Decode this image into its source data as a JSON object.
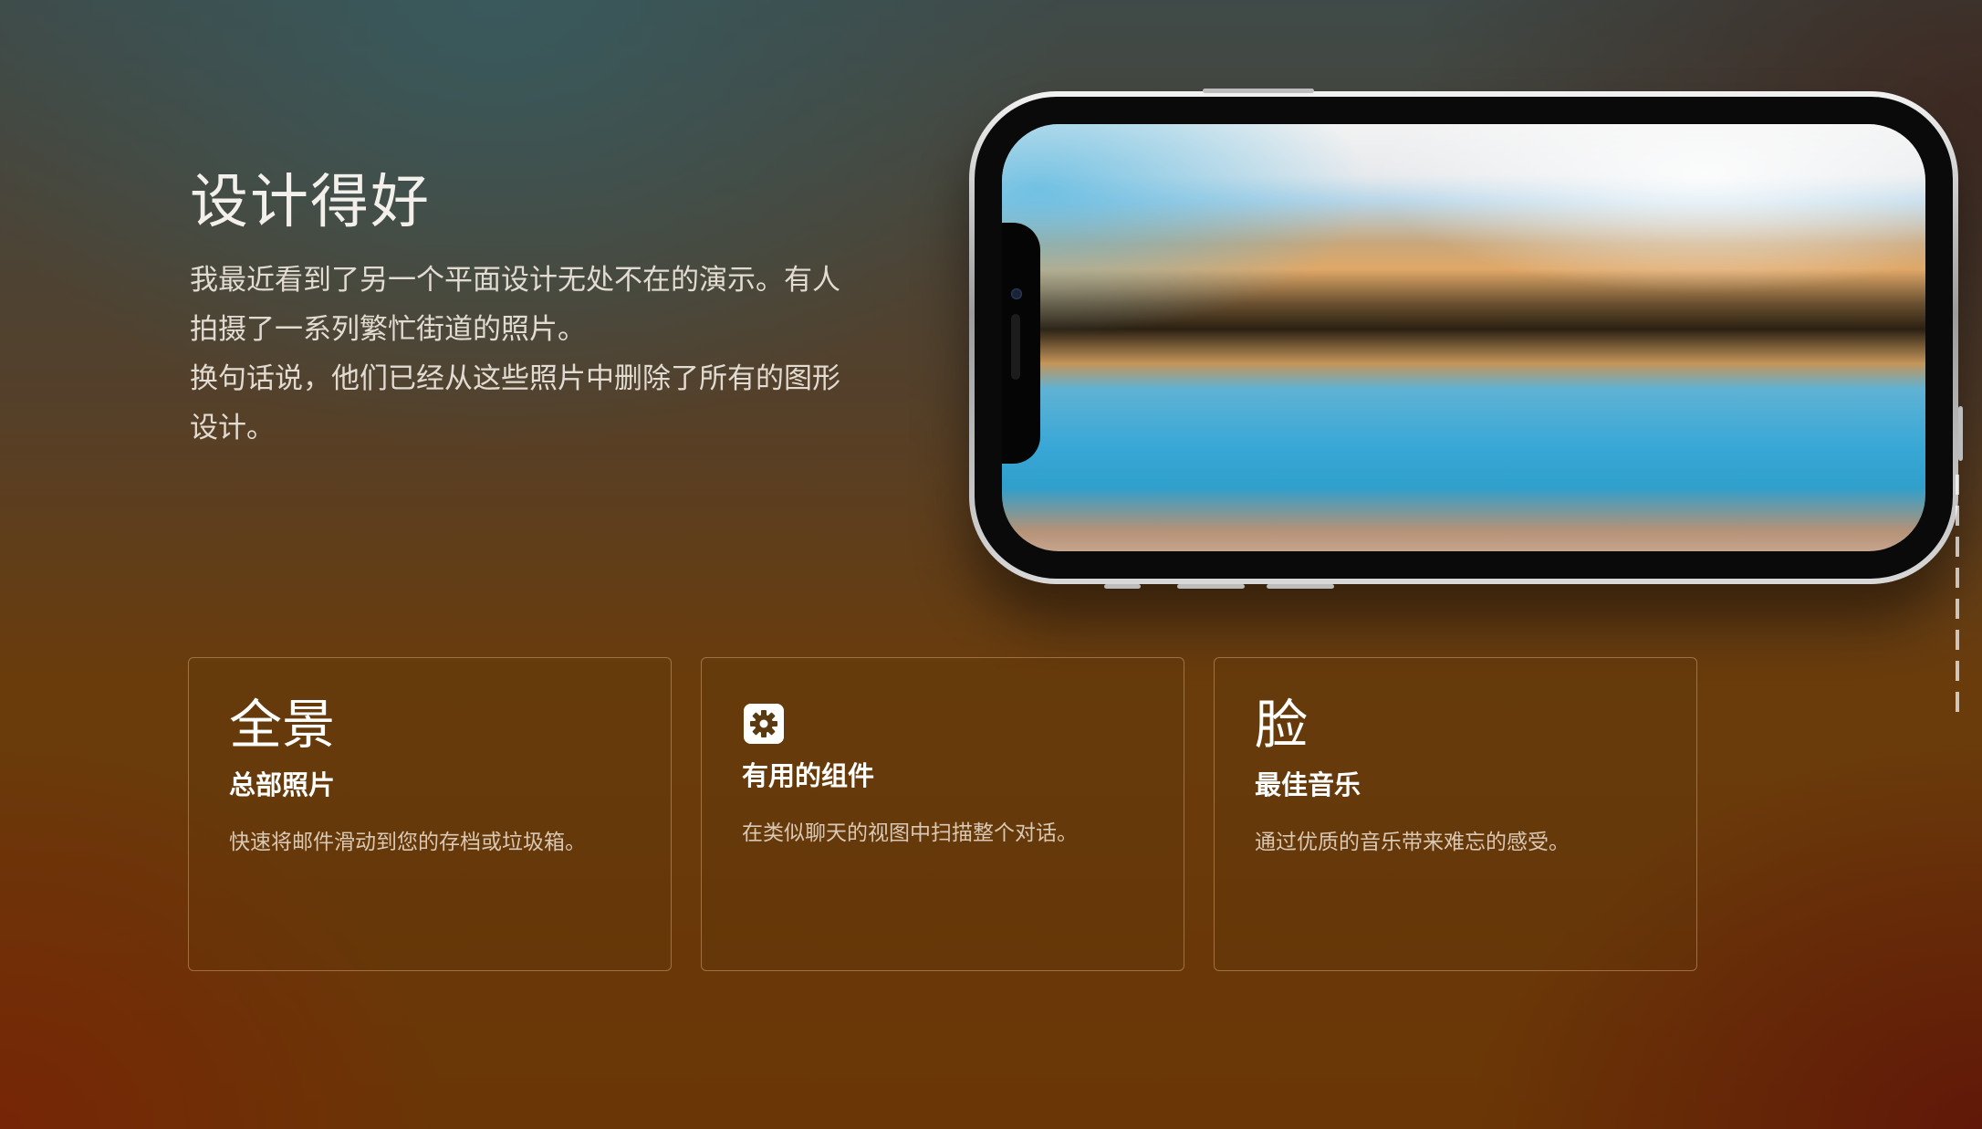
{
  "hero": {
    "title": "设计得好",
    "paragraphs": [
      "我最近看到了另一个平面设计无处不在的演示。有人拍摄了一系列繁忙街道的照片。",
      "换句话说，他们已经从这些照片中删除了所有的图形设计。"
    ]
  },
  "cards": [
    {
      "badge": "全景",
      "icon": null,
      "title": "总部照片",
      "description": "快速将邮件滑动到您的存档或垃圾箱。"
    },
    {
      "badge": null,
      "icon": "gear-icon",
      "title": "有用的组件",
      "description": "在类似聊天的视图中扫描整个对话。"
    },
    {
      "badge": "脸",
      "icon": null,
      "title": "最佳音乐",
      "description": "通过优质的音乐带来难忘的感受。"
    }
  ],
  "colors": {
    "text_primary": "#ffffff",
    "text_secondary": "#d9c8b4",
    "card_border": "#c89868"
  }
}
